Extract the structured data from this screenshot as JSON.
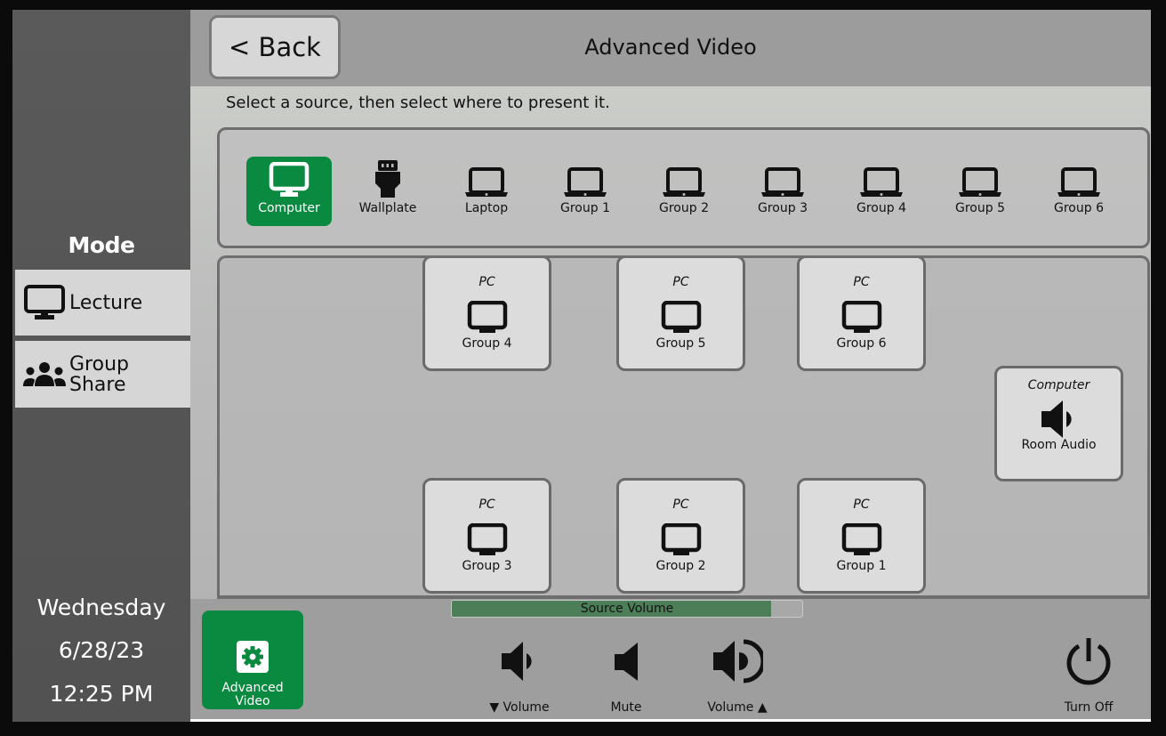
{
  "sidebar": {
    "mode_title": "Mode",
    "modes": [
      {
        "label": "Lecture",
        "icon": "monitor-icon"
      },
      {
        "label": "Group\nShare",
        "icon": "users-icon"
      }
    ],
    "datetime": {
      "day": "Wednesday",
      "date": "6/28/23",
      "time": "12:25 PM"
    }
  },
  "header": {
    "back_label": "< Back",
    "title": "Advanced Video"
  },
  "content": {
    "instruction": "Select a source, then select where to present it.",
    "sources": [
      {
        "label": "Computer",
        "icon": "monitor-icon",
        "selected": true
      },
      {
        "label": "Wallplate",
        "icon": "hdmi-plug-icon",
        "selected": false
      },
      {
        "label": "Laptop",
        "icon": "laptop-icon",
        "selected": false
      },
      {
        "label": "Group 1",
        "icon": "laptop-icon",
        "selected": false
      },
      {
        "label": "Group 2",
        "icon": "laptop-icon",
        "selected": false
      },
      {
        "label": "Group 3",
        "icon": "laptop-icon",
        "selected": false
      },
      {
        "label": "Group 4",
        "icon": "laptop-icon",
        "selected": false
      },
      {
        "label": "Group 5",
        "icon": "laptop-icon",
        "selected": false
      },
      {
        "label": "Group 6",
        "icon": "laptop-icon",
        "selected": false
      }
    ],
    "destinations": [
      {
        "label": "Group 4",
        "current_source": "PC",
        "icon": "monitor-icon"
      },
      {
        "label": "Group 5",
        "current_source": "PC",
        "icon": "monitor-icon"
      },
      {
        "label": "Group 6",
        "current_source": "PC",
        "icon": "monitor-icon"
      },
      {
        "label": "Room Audio",
        "current_source": "Computer",
        "icon": "speaker-icon"
      },
      {
        "label": "Group 3",
        "current_source": "PC",
        "icon": "monitor-icon"
      },
      {
        "label": "Group 2",
        "current_source": "PC",
        "icon": "monitor-icon"
      },
      {
        "label": "Group 1",
        "current_source": "PC",
        "icon": "monitor-icon"
      }
    ]
  },
  "bottom": {
    "advanced_video_label": "Advanced\nVideo",
    "source_volume": {
      "label": "Source Volume",
      "level_percent": 91
    },
    "volume_down_label": "▼ Volume",
    "mute_label": "Mute",
    "volume_up_label": "Volume ▲",
    "turn_off_label": "Turn Off"
  },
  "colors": {
    "accent_green": "#0a8a40",
    "volume_fill": "#4c7f58"
  }
}
